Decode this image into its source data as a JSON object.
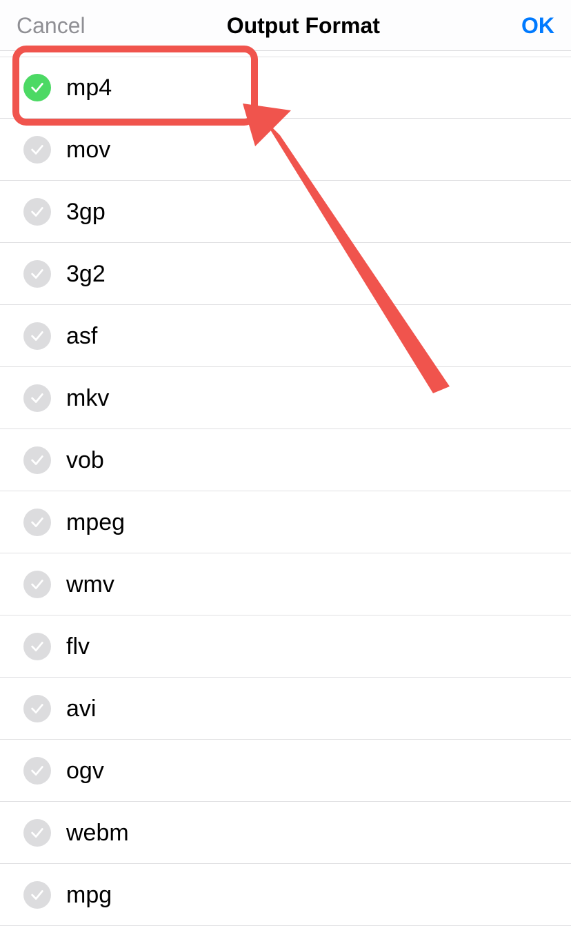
{
  "nav": {
    "cancel": "Cancel",
    "title": "Output Format",
    "ok": "OK"
  },
  "options": {
    "items": [
      {
        "label": "mp4",
        "selected": true
      },
      {
        "label": "mov",
        "selected": false
      },
      {
        "label": "3gp",
        "selected": false
      },
      {
        "label": "3g2",
        "selected": false
      },
      {
        "label": "asf",
        "selected": false
      },
      {
        "label": "mkv",
        "selected": false
      },
      {
        "label": "vob",
        "selected": false
      },
      {
        "label": "mpeg",
        "selected": false
      },
      {
        "label": "wmv",
        "selected": false
      },
      {
        "label": "flv",
        "selected": false
      },
      {
        "label": "avi",
        "selected": false
      },
      {
        "label": "ogv",
        "selected": false
      },
      {
        "label": "webm",
        "selected": false
      },
      {
        "label": "mpg",
        "selected": false
      }
    ]
  },
  "colors": {
    "accent": "#007aff",
    "selected_check": "#4cd964",
    "unselected_check": "#dcdcde",
    "annotation": "#f0544d"
  }
}
